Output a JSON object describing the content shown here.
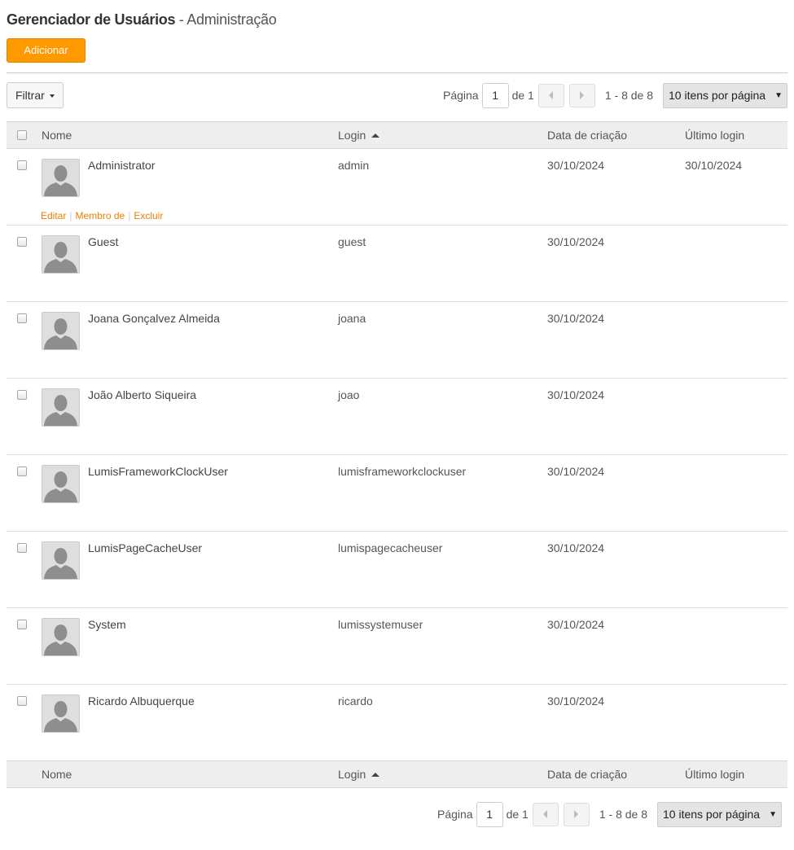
{
  "header": {
    "title_bold": "Gerenciador de Usuários",
    "title_rest": " - Administração",
    "add_label": "Adicionar"
  },
  "filter": {
    "label": "Filtrar"
  },
  "pagination": {
    "page_label": "Página",
    "current_page": "1",
    "of_label": "de 1",
    "range": "1 - 8 de 8",
    "per_page": "10 itens por página"
  },
  "table": {
    "columns": {
      "name": "Nome",
      "login": "Login",
      "created": "Data de criação",
      "last_login": "Último login"
    },
    "row_actions": [
      "Editar",
      "Membro de",
      "Excluir"
    ],
    "rows": [
      {
        "name": "Administrator",
        "login": "admin",
        "created": "30/10/2024",
        "last_login": "30/10/2024"
      },
      {
        "name": "Guest",
        "login": "guest",
        "created": "30/10/2024",
        "last_login": ""
      },
      {
        "name": "Joana Gonçalvez Almeida",
        "login": "joana",
        "created": "30/10/2024",
        "last_login": ""
      },
      {
        "name": "João Alberto Siqueira",
        "login": "joao",
        "created": "30/10/2024",
        "last_login": ""
      },
      {
        "name": "LumisFrameworkClockUser",
        "login": "lumisframeworkclockuser",
        "created": "30/10/2024",
        "last_login": ""
      },
      {
        "name": "LumisPageCacheUser",
        "login": "lumispagecacheuser",
        "created": "30/10/2024",
        "last_login": ""
      },
      {
        "name": "System",
        "login": "lumissystemuser",
        "created": "30/10/2024",
        "last_login": ""
      },
      {
        "name": "Ricardo Albuquerque",
        "login": "ricardo",
        "created": "30/10/2024",
        "last_login": ""
      }
    ]
  },
  "colors": {
    "accent": "#ff9900",
    "link": "#ef7d00",
    "header_bg": "#eeeeee"
  },
  "icons": {
    "avatar": "user-silhouette-icon",
    "sort": "sort-ascending-icon",
    "prev": "chevron-left-icon",
    "next": "chevron-right-icon"
  }
}
